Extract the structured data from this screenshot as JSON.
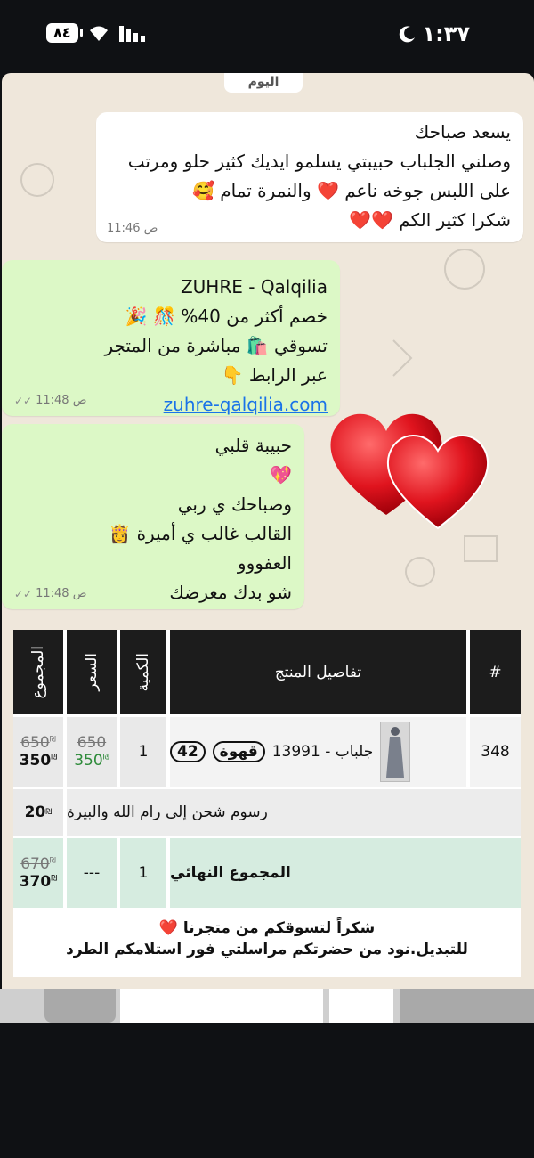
{
  "status_bar": {
    "time": "١:٣٧",
    "battery": "٨٤"
  },
  "chat": {
    "date_chip": "اليوم",
    "incoming": {
      "lines": [
        "يسعد صباحك",
        "وصلني الجلباب حبيبتي يسلمو ايديك كثير حلو ومرتب",
        "على اللبس جوخه ناعم ❤️ والنمرة تمام 🥰",
        "شكرا كثير الكم ❤️❤️"
      ],
      "time": "11:46 ص"
    },
    "outgoing_1": {
      "lines": [
        "ZUHRE - Qalqilia",
        "خصم أكثر من 40% 🎊 🎉",
        "تسوقي 🛍️ مباشرة من المتجر",
        "عبر الرابط 👇"
      ],
      "link": "zuhre-qalqilia.com",
      "time": "11:48 ص"
    },
    "outgoing_2": {
      "lines": [
        "حبيبة قلبي",
        "💖",
        "وصباحك ي ربي",
        "القالب غالب ي أميرة 👸",
        "العفووو",
        "شو بدك معرضك"
      ],
      "time": "11:48 ص"
    }
  },
  "invoice": {
    "headers": {
      "num": "#",
      "details": "تفاصيل المنتج",
      "qty": "الكمية",
      "price": "السعر",
      "total": "المجموع"
    },
    "row": {
      "num": "348",
      "product_name": "جلباب - 13991",
      "color_tag": "قهوة",
      "size_tag": "42",
      "qty": "1",
      "price_old": "650",
      "price_new": "350",
      "total_old": "650",
      "total_new": "350",
      "currency": "₪"
    },
    "shipping": {
      "label": "رسوم شحن إلى رام الله والبيرة",
      "value": "20"
    },
    "grand_total": {
      "label": "المجموع النهائي",
      "qty": "1",
      "price": "---",
      "old": "670",
      "new": "370"
    }
  },
  "thanks": {
    "line1": "شكراً لتسوقكم من متجرنا ❤️",
    "line2": "للتبديل.نود من حضرتكم مراسلتي فور استلامكم الطرد"
  },
  "colors": {
    "incoming_bubble": "#ffffff",
    "outgoing_bubble": "#dcf8c6",
    "chat_bg": "#efe7db",
    "header_dark": "#1c1c1c",
    "green_row": "#d6ece0"
  }
}
